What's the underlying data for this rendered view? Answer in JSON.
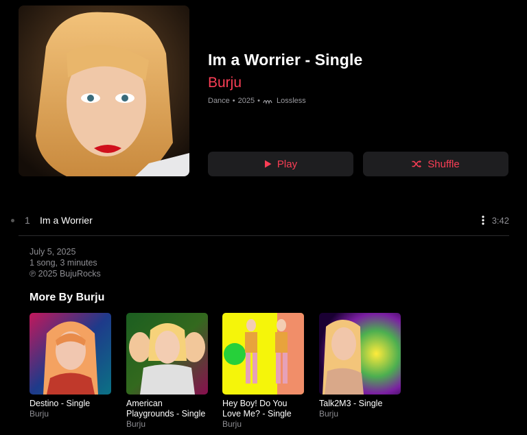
{
  "album": {
    "title": "Im a Worrier - Single",
    "artist": "Burju",
    "genre": "Dance",
    "year": "2025",
    "quality": "Lossless",
    "separator": "•"
  },
  "buttons": {
    "play": "Play",
    "shuffle": "Shuffle"
  },
  "tracks": [
    {
      "number": "1",
      "title": "Im a Worrier",
      "duration": "3:42"
    }
  ],
  "info": {
    "date": "July 5, 2025",
    "summary": "1 song, 3 minutes",
    "copyright": "℗ 2025 BujuRocks"
  },
  "more_by": {
    "heading": "More By Burju",
    "items": [
      {
        "title": "Destino - Single",
        "artist": "Burju"
      },
      {
        "title": "American Playgrounds - Single",
        "artist": "Burju"
      },
      {
        "title": "Hey Boy! Do You Love Me? - Single",
        "artist": "Burju"
      },
      {
        "title": "Talk2M3 - Single",
        "artist": "Burju"
      }
    ]
  },
  "colors": {
    "accent": "#fa3e55",
    "background": "#000000",
    "button_bg": "#1e1e20",
    "secondary_text": "#8e8e93"
  }
}
